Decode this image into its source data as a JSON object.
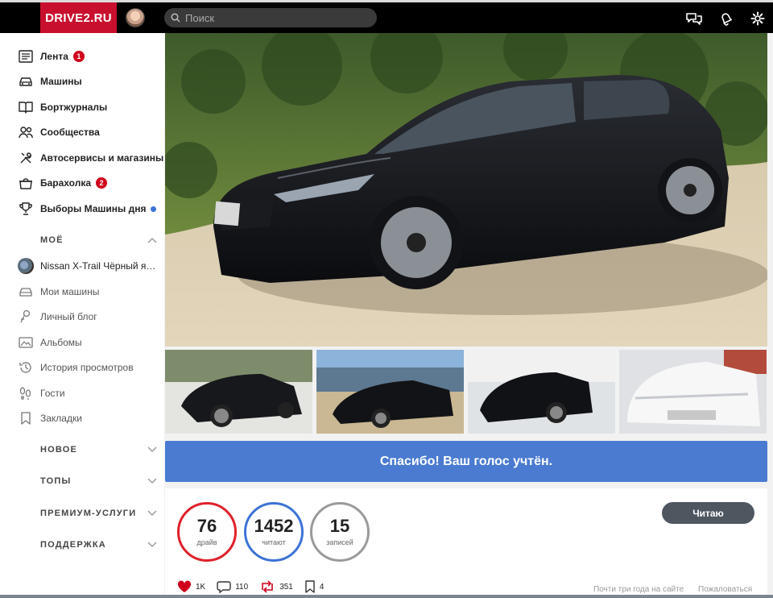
{
  "header": {
    "logo": "DRIVE2.RU",
    "search_placeholder": "Поиск"
  },
  "sidebar": {
    "main_items": [
      {
        "label": "Лента",
        "badge": "1",
        "icon": "feed-icon"
      },
      {
        "label": "Машины",
        "icon": "car-icon"
      },
      {
        "label": "Бортжурналы",
        "icon": "logbook-icon"
      },
      {
        "label": "Сообщества",
        "icon": "people-icon"
      },
      {
        "label": "Автосервисы и магазины",
        "icon": "wrench-icon"
      },
      {
        "label": "Барахолка",
        "badge": "2",
        "icon": "market-icon"
      },
      {
        "label": "Выборы Машины дня",
        "icon": "trophy-icon"
      }
    ],
    "my_section": "МОЁ",
    "my_items": [
      {
        "label": "Nissan X-Trail Чёрный я…",
        "icon": "car-avatar"
      },
      {
        "label": "Мои машины",
        "icon": "car-outline-icon"
      },
      {
        "label": "Личный блог",
        "icon": "blog-icon"
      },
      {
        "label": "Альбомы",
        "icon": "album-icon"
      },
      {
        "label": "История просмотров",
        "icon": "history-icon"
      },
      {
        "label": "Гости",
        "icon": "footprints-icon"
      },
      {
        "label": "Закладки",
        "icon": "bookmark-icon"
      }
    ],
    "sections": [
      "НОВОЕ",
      "ТОПЫ",
      "ПРЕМИУМ-УСЛУГИ",
      "ПОДДЕРЖКА"
    ]
  },
  "vote_banner": "Спасибо! Ваш голос учтён.",
  "stats": [
    {
      "value": "76",
      "label": "драйв",
      "color": "#e0202a"
    },
    {
      "value": "1452",
      "label": "читают",
      "color": "#3d73d6"
    },
    {
      "value": "15",
      "label": "записей",
      "color": "#9a9a9a"
    }
  ],
  "read_button": "Читаю",
  "actions": {
    "likes": "1K",
    "comments": "110",
    "reposts": "351",
    "bookmarks": "4"
  },
  "footer": {
    "since": "Почти три года на сайте",
    "complain": "Пожаловаться"
  },
  "colors": {
    "brand": "#c8102e",
    "banner": "#4a7bd1"
  }
}
